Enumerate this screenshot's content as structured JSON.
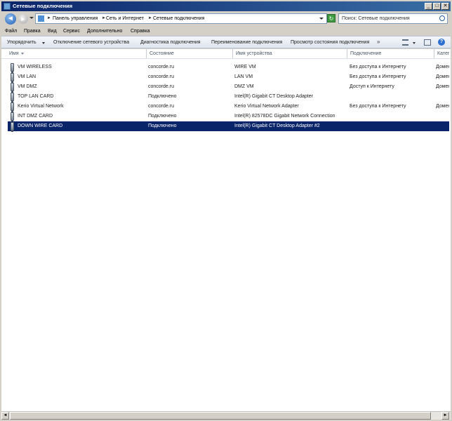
{
  "window": {
    "title": "Сетевые подключения",
    "minimize_glyph": "_",
    "maximize_glyph": "□",
    "close_glyph": "✕"
  },
  "address": {
    "back_glyph": "◄",
    "forward_glyph": "►",
    "crumbs": [
      "Панель управления",
      "Сеть и Интернет",
      "Сетевые подключения"
    ],
    "separator": "►",
    "refresh_glyph": "↻",
    "search_placeholder": "Поиск: Сетевые подключения"
  },
  "menu": [
    "Файл",
    "Правка",
    "Вид",
    "Сервис",
    "Дополнительно",
    "Справка"
  ],
  "toolbar": {
    "organize": "Упорядочить",
    "items": [
      "Отключение сетевого устройства",
      "Диагностика подключения",
      "Переименование подключения",
      "Просмотр состояния подключения"
    ],
    "more": "»",
    "help_glyph": "?"
  },
  "columns": [
    "Имя",
    "Состояние",
    "Имя устройства",
    "Подключение",
    "Катег"
  ],
  "rows": [
    {
      "name": "VM WIRELESS",
      "state": "concorde.ru",
      "device": "WIRE VM",
      "connection": "Без доступа к Интернету",
      "category": "Домен"
    },
    {
      "name": "VM LAN",
      "state": "concorde.ru",
      "device": "LAN VM",
      "connection": "Без доступа к Интернету",
      "category": "Домен"
    },
    {
      "name": "VM DMZ",
      "state": "concorde.ru",
      "device": "DMZ VM",
      "connection": "Доступ к Интернету",
      "category": "Домен"
    },
    {
      "name": "TOP LAN CARD",
      "state": "Подключено",
      "device": "Intel(R) Gigabit CT Desktop Adapter",
      "connection": "",
      "category": ""
    },
    {
      "name": "Kerio Virtual Network",
      "state": "concorde.ru",
      "device": "Kerio Virtual Network Adapter",
      "connection": "Без доступа к Интернету",
      "category": "Домен"
    },
    {
      "name": "INT DMZ CARD",
      "state": "Подключено",
      "device": "Intel(R) 82578DC Gigabit Network Connection",
      "connection": "",
      "category": ""
    },
    {
      "name": "DOWN WIRE CARD",
      "state": "Подключено",
      "device": "Intel(R) Gigabit CT Desktop Adapter #2",
      "connection": "",
      "category": ""
    }
  ],
  "selected_row": 6,
  "colors": {
    "selection": "#0a246a",
    "titlebar": "#0a246a"
  }
}
